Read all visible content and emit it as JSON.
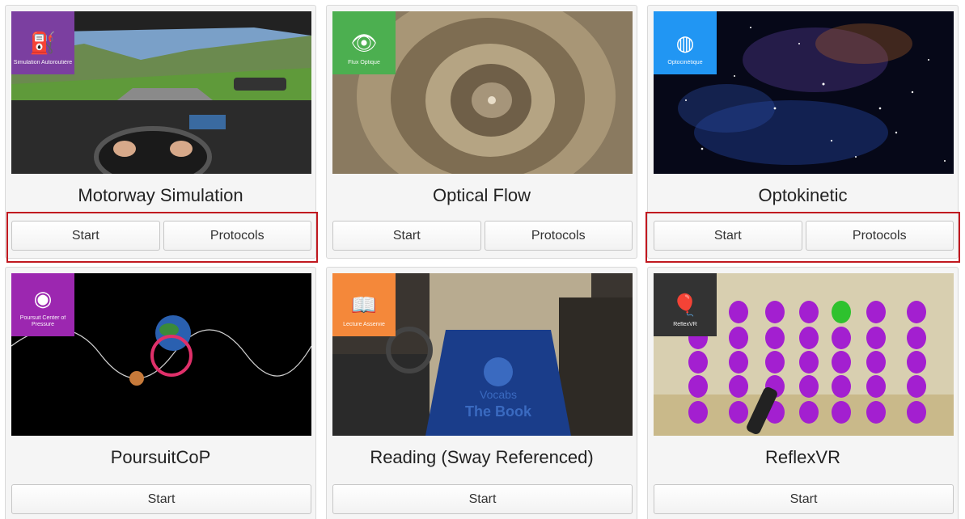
{
  "accent_color": "#c0181f",
  "cards": [
    {
      "title": "Motorway Simulation",
      "badge": {
        "label": "Simulation Autoroutière",
        "icon": "motorway-icon",
        "color": "#7b3fa0"
      },
      "buttons": [
        "Start",
        "Protocols"
      ],
      "highlighted": true
    },
    {
      "title": "Optical Flow",
      "badge": {
        "label": "Flux Optique",
        "icon": "eye-icon",
        "color": "#4caf50"
      },
      "buttons": [
        "Start",
        "Protocols"
      ],
      "highlighted": false
    },
    {
      "title": "Optokinetic",
      "badge": {
        "label": "Optocinétique",
        "icon": "striped-sphere-icon",
        "color": "#2196f3"
      },
      "buttons": [
        "Start",
        "Protocols"
      ],
      "highlighted": true
    },
    {
      "title": "PoursuitCoP",
      "badge": {
        "label": "Poursuit Center of Pressure",
        "icon": "target-icon",
        "color": "#9c27b0"
      },
      "buttons": [
        "Start"
      ],
      "highlighted": false
    },
    {
      "title": "Reading (Sway Referenced)",
      "badge": {
        "label": "Lecture Asservie",
        "icon": "book-icon",
        "color": "#f4883a"
      },
      "buttons": [
        "Start"
      ],
      "highlighted": false
    },
    {
      "title": "ReflexVR",
      "badge": {
        "label": "ReflexVR",
        "icon": "balloon-icon",
        "color": "#333333"
      },
      "buttons": [
        "Start"
      ],
      "highlighted": false
    }
  ],
  "scene_text": {
    "book_line1": "Vocabs",
    "book_line2": "The Book"
  }
}
